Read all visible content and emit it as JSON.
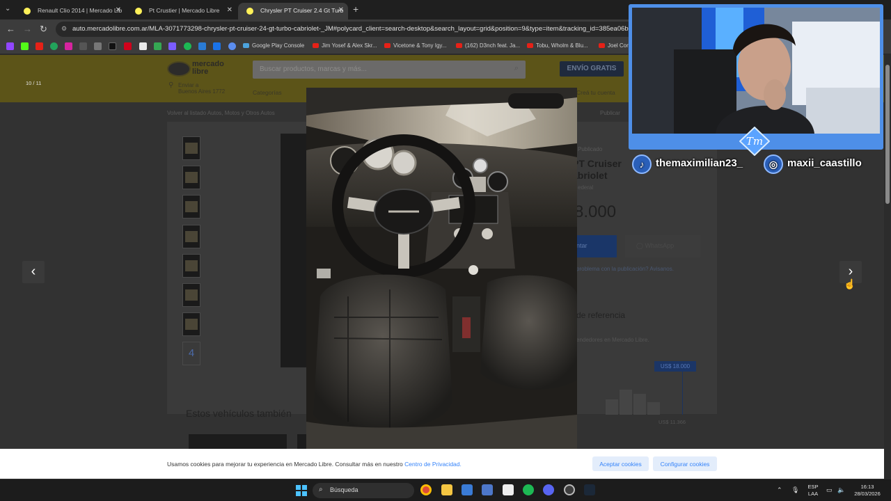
{
  "browser": {
    "tabs": [
      {
        "label": "Renault Clio 2014 | Mercado Lib",
        "active": false
      },
      {
        "label": "Pt Crustier | Mercado Libre",
        "active": false
      },
      {
        "label": "Chrysler PT Cruiser 2.4 Gt Turb",
        "active": true
      }
    ],
    "url": "auto.mercadolibre.com.ar/MLA-3071773298-chrysler-pt-cruiser-24-gt-turbo-cabriolet-_JM#polycard_client=search-desktop&search_layout=grid&position=9&type=item&tracking_id=385ea06b",
    "bookmarks": [
      "Google Play Console",
      "Jim Yosef & Alex Skr...",
      "Vicetone & Tony Igy...",
      "(162) D3nch feat. Ja...",
      "Tobu, Wholm & Blu...",
      "Joel Cor"
    ]
  },
  "page": {
    "logo_text": "mercado\nlibre",
    "search_placeholder": "Buscar productos, marcas y más...",
    "shipping_banner": "ENVÍO GRATIS",
    "address": "Enviar a\nBuenos Aires 1772",
    "nav_categories": "Categorías",
    "nav_cta": "Creá tu cuenta",
    "breadcrumb": "Volver al listado   Autos, Motos y Otros   Autos",
    "share": "Publicar",
    "date_posted": "Publicado",
    "title": "PT Cruiser\nabriolet",
    "subtitle": "ederal",
    "price": "8.000",
    "contact_button": "ntar",
    "whatsapp_button": "WhatsApp",
    "report_link": "problema con la publicación? Avisanos.",
    "reference_title": "de referencia",
    "reference_subtitle": "endedores en Mercado Libre.",
    "reference_badge": "US$ 18.000",
    "reference_min": "US$ 11.366",
    "related_title": "Estos vehículos también",
    "km": "m",
    "thumbnail_more": "4"
  },
  "lightbox": {
    "counter": "10 / 11",
    "prev_glyph": "‹",
    "next_glyph": "›"
  },
  "cookie_banner": {
    "text": "Usamos cookies para mejorar tu experiencia en Mercado Libre. Consultar más en nuestro",
    "link": "Centro de Privacidad.",
    "accept": "Aceptar cookies",
    "configure": "Configurar cookies"
  },
  "webcam": {
    "logo": "Tm",
    "tiktok_handle": "themaximilian23_",
    "instagram_handle": "maxii_caastillo"
  },
  "taskbar": {
    "search": "Búsqueda",
    "lang_top": "ESP",
    "lang_bottom": "LAA",
    "time": "16:13",
    "date": "28/03/2026"
  },
  "colors": {
    "ml_yellow_dimmed": "#5c5418",
    "ml_blue": "#3483fa",
    "webcam_border": "#4e8fe8"
  }
}
